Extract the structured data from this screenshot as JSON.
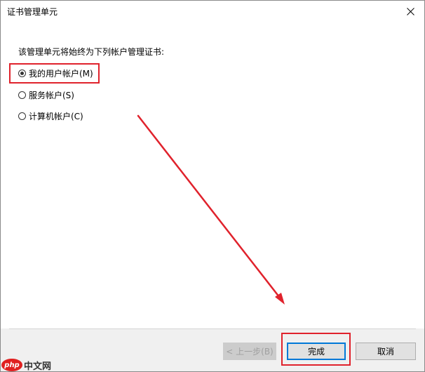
{
  "window": {
    "title": "证书管理单元"
  },
  "content": {
    "instruction": "该管理单元将始终为下列帐户管理证书:",
    "options": [
      {
        "label": "我的用户帐户(M)",
        "checked": true
      },
      {
        "label": "服务帐户(S)",
        "checked": false
      },
      {
        "label": "计算机帐户(C)",
        "checked": false
      }
    ]
  },
  "footer": {
    "back_label": "< 上一步(B)",
    "finish_label": "完成",
    "cancel_label": "取消"
  },
  "watermark": {
    "logo_text": "php",
    "site_text": "中文网"
  },
  "colors": {
    "annotation": "#e0222c",
    "focus_border": "#0078d7"
  },
  "icons": {
    "close": "close-icon",
    "arrow": "arrow-annotation"
  }
}
